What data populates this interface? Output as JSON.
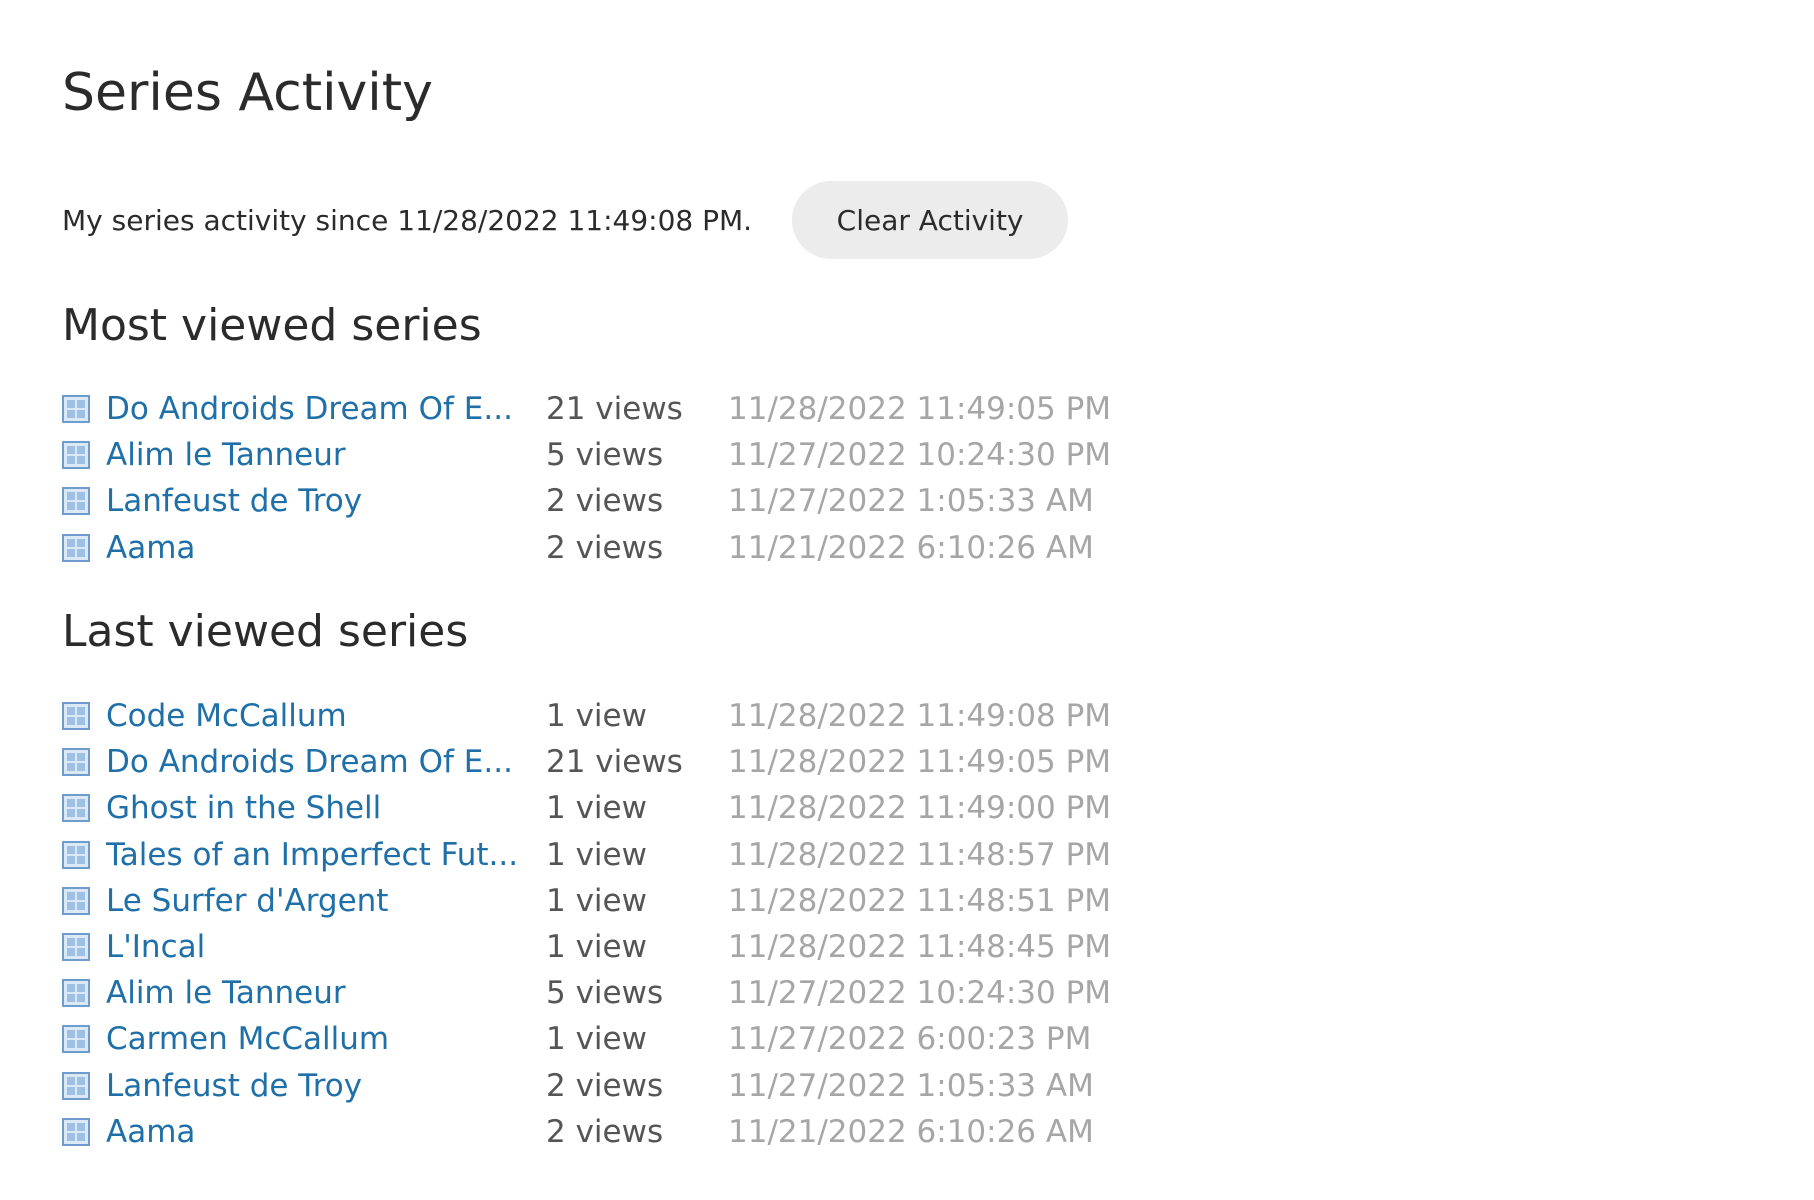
{
  "page": {
    "title": "Series Activity"
  },
  "activity": {
    "since_text": "My series activity since 11/28/2022 11:49:08 PM.",
    "clear_button_label": "Clear Activity"
  },
  "colors": {
    "link": "#1f6fa8",
    "views_text": "#555555",
    "timestamp_text": "#a6a6a6",
    "button_bg": "#ececec"
  },
  "most_viewed": {
    "heading": "Most viewed series",
    "items": [
      {
        "icon": "series-grid-icon",
        "title": "Do Androids Dream Of E...",
        "views": "21 views",
        "time": "11/28/2022 11:49:05 PM"
      },
      {
        "icon": "series-grid-icon",
        "title": "Alim le Tanneur",
        "views": "5 views",
        "time": "11/27/2022 10:24:30 PM"
      },
      {
        "icon": "series-grid-icon",
        "title": "Lanfeust de Troy",
        "views": "2 views",
        "time": "11/27/2022 1:05:33 AM"
      },
      {
        "icon": "series-grid-icon",
        "title": "Aama",
        "views": "2 views",
        "time": "11/21/2022 6:10:26 AM"
      }
    ]
  },
  "last_viewed": {
    "heading": "Last viewed series",
    "items": [
      {
        "icon": "series-grid-icon",
        "title": "Code McCallum",
        "views": "1 view",
        "time": "11/28/2022 11:49:08 PM"
      },
      {
        "icon": "series-grid-icon",
        "title": "Do Androids Dream Of E...",
        "views": "21 views",
        "time": "11/28/2022 11:49:05 PM"
      },
      {
        "icon": "series-grid-icon",
        "title": "Ghost in the Shell",
        "views": "1 view",
        "time": "11/28/2022 11:49:00 PM"
      },
      {
        "icon": "series-grid-icon",
        "title": "Tales of an Imperfect Fut...",
        "views": "1 view",
        "time": "11/28/2022 11:48:57 PM"
      },
      {
        "icon": "series-grid-icon",
        "title": "Le Surfer d'Argent",
        "views": "1 view",
        "time": "11/28/2022 11:48:51 PM"
      },
      {
        "icon": "series-grid-icon",
        "title": "L'Incal",
        "views": "1 view",
        "time": "11/28/2022 11:48:45 PM"
      },
      {
        "icon": "series-grid-icon",
        "title": "Alim le Tanneur",
        "views": "5 views",
        "time": "11/27/2022 10:24:30 PM"
      },
      {
        "icon": "series-grid-icon",
        "title": "Carmen McCallum",
        "views": "1 view",
        "time": "11/27/2022 6:00:23 PM"
      },
      {
        "icon": "series-grid-icon",
        "title": "Lanfeust de Troy",
        "views": "2 views",
        "time": "11/27/2022 1:05:33 AM"
      },
      {
        "icon": "series-grid-icon",
        "title": "Aama",
        "views": "2 views",
        "time": "11/21/2022 6:10:26 AM"
      }
    ]
  }
}
